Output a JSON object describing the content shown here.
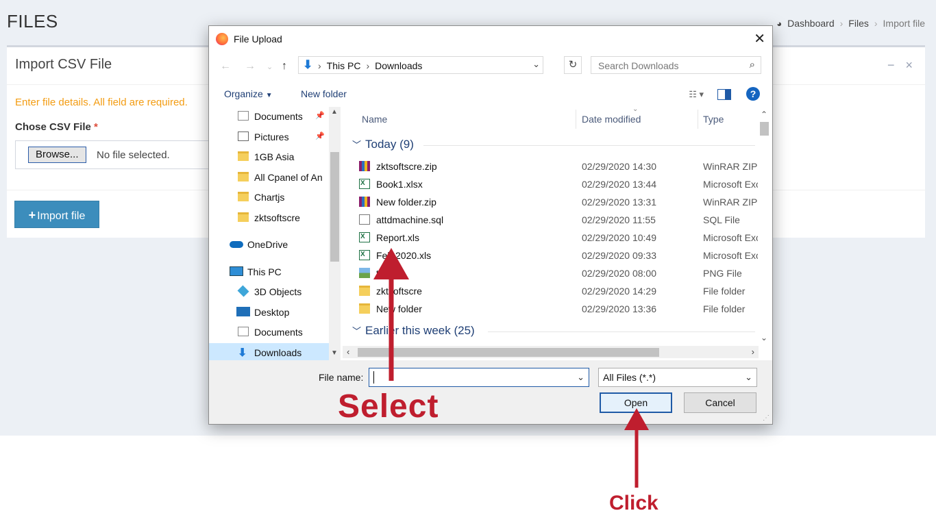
{
  "page": {
    "title": "FILES",
    "breadcrumb": [
      "Dashboard",
      "Files",
      "Import file"
    ]
  },
  "box": {
    "title": "Import CSV File",
    "hint": "Enter file details. All field are required.",
    "field_label": "Chose CSV File",
    "required_mark": "*",
    "browse_label": "Browse...",
    "no_file": "No file selected.",
    "import_label": "Import file",
    "import_icon": "plus-icon"
  },
  "dialog": {
    "title": "File Upload",
    "address": [
      "This PC",
      "Downloads"
    ],
    "search_placeholder": "Search Downloads",
    "organize": "Organize",
    "new_folder": "New folder",
    "nav_items": [
      {
        "label": "Documents",
        "icon": "documents-icon",
        "pinned": true
      },
      {
        "label": "Pictures",
        "icon": "pictures-icon",
        "pinned": true
      },
      {
        "label": "1GB Asia",
        "icon": "folder-icon"
      },
      {
        "label": "All Cpanel of An",
        "icon": "folder-icon"
      },
      {
        "label": "Chartjs",
        "icon": "folder-icon"
      },
      {
        "label": "zktsoftscre",
        "icon": "folder-icon"
      },
      {
        "label": "OneDrive",
        "icon": "onedrive-icon"
      },
      {
        "label": "This PC",
        "icon": "this-pc-icon"
      },
      {
        "label": "3D Objects",
        "icon": "3d-objects-icon"
      },
      {
        "label": "Desktop",
        "icon": "desktop-icon"
      },
      {
        "label": "Documents",
        "icon": "documents-icon"
      },
      {
        "label": "Downloads",
        "icon": "downloads-icon"
      }
    ],
    "columns": [
      "Name",
      "Date modified",
      "Type"
    ],
    "groups": [
      {
        "label": "Today (9)",
        "files": [
          {
            "name": "zktsoftscre.zip",
            "date": "02/29/2020 14:30",
            "type": "WinRAR ZIP a",
            "icon": "zip-icon"
          },
          {
            "name": "Book1.xlsx",
            "date": "02/29/2020 13:44",
            "type": "Microsoft Exc",
            "icon": "excel-icon"
          },
          {
            "name": "New folder.zip",
            "date": "02/29/2020 13:31",
            "type": "WinRAR ZIP a",
            "icon": "zip-icon"
          },
          {
            "name": "attdmachine.sql",
            "date": "02/29/2020 11:55",
            "type": "SQL File",
            "icon": "sql-file-icon"
          },
          {
            "name": "Report.xls",
            "date": "02/29/2020 10:49",
            "type": "Microsoft Exc",
            "icon": "excel-icon"
          },
          {
            "name": "Feb 2020.xls",
            "date": "02/29/2020 09:33",
            "type": "Microsoft Exc",
            "icon": "excel-icon"
          },
          {
            "name": "to.png",
            "date": "02/29/2020 08:00",
            "type": "PNG File",
            "icon": "png-icon"
          },
          {
            "name": "zktsoftscre",
            "date": "02/29/2020 14:29",
            "type": "File folder",
            "icon": "folder-icon"
          },
          {
            "name": "New folder",
            "date": "02/29/2020 13:36",
            "type": "File folder",
            "icon": "folder-icon"
          }
        ]
      },
      {
        "label": "Earlier this week (25)",
        "files": []
      }
    ],
    "file_name_label": "File name:",
    "file_name_value": "",
    "file_type": "All Files (*.*)",
    "open_label": "Open",
    "cancel_label": "Cancel"
  },
  "annotations": {
    "select": "Select",
    "click": "Click",
    "color": "#bf1e2e"
  }
}
